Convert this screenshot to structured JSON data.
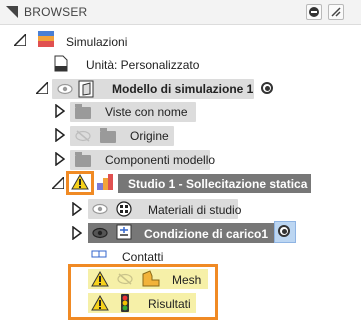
{
  "header": {
    "title": "BROWSER"
  },
  "tree": {
    "root_label": "Simulazioni",
    "units_label": "Unità: Personalizzato",
    "model_label": "Modello di simulazione 1",
    "named_views_label": "Viste con nome",
    "origin_label": "Origine",
    "model_components_label": "Componenti modello",
    "study_label": "Studio 1 - Sollecitazione statica",
    "materials_label": "Materiali di studio",
    "load_case_label": "Condizione di carico1",
    "contacts_label": "Contatti",
    "mesh_label": "Mesh",
    "results_label": "Risultati"
  },
  "colors": {
    "highlight_orange": "#f08a24",
    "warning_yellow": "#f7d21a",
    "selected_row": "#777777",
    "row_background": "#dcdcdc",
    "warning_row_background": "#f6f0a8"
  }
}
